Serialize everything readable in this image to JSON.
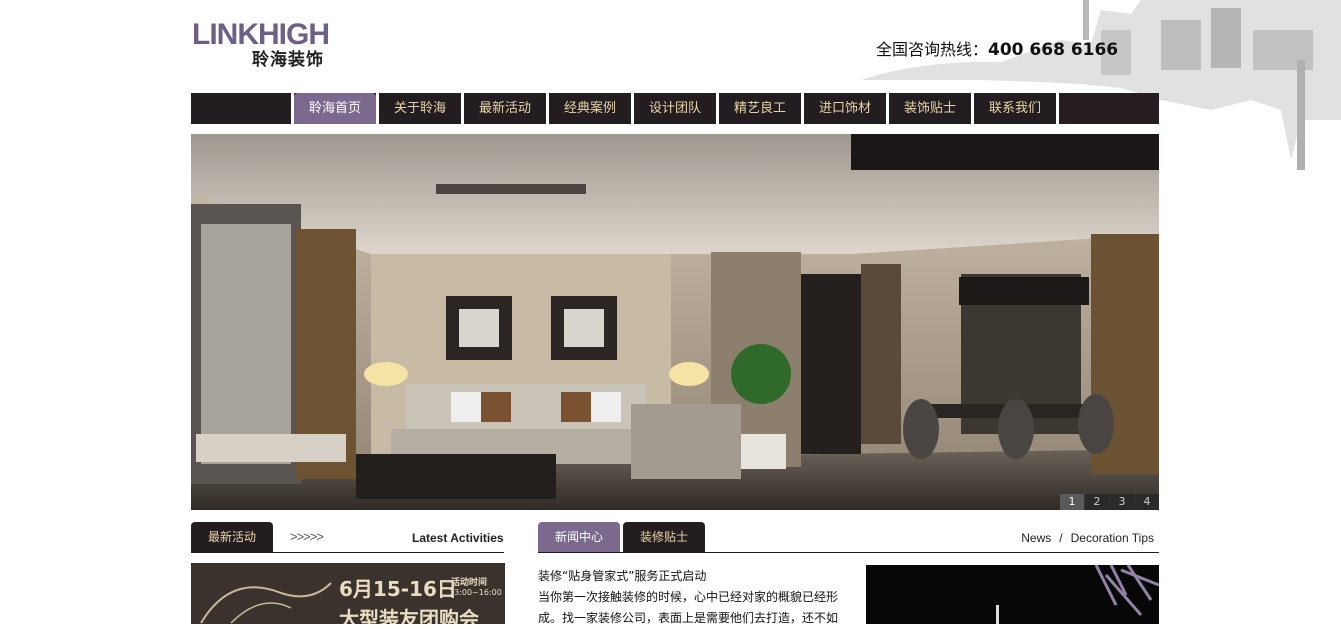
{
  "brand": {
    "logo_en": "LINKHIGH",
    "logo_cn": "聆海装饰"
  },
  "hotline": {
    "label": "全国咨询热线：",
    "number": "400 668 6166"
  },
  "nav": {
    "items": [
      {
        "label": "聆海首页",
        "active": true
      },
      {
        "label": "关于聆海"
      },
      {
        "label": "最新活动"
      },
      {
        "label": "经典案例"
      },
      {
        "label": "设计团队"
      },
      {
        "label": "精艺良工"
      },
      {
        "label": "进口饰材"
      },
      {
        "label": "装饰贴士"
      },
      {
        "label": "联系我们"
      }
    ]
  },
  "banner": {
    "pages": [
      "1",
      "2",
      "3",
      "4"
    ],
    "active_page": "1"
  },
  "activities": {
    "tab_label": "最新活动",
    "arrows": ">>>>>",
    "title_en": "Latest Activities",
    "promo": {
      "date": "6月15-16日",
      "time_label": "活动时间",
      "time": "13:00~16:00",
      "headline": "大型装友团购会"
    }
  },
  "news": {
    "tabs": [
      {
        "label": "新闻中心",
        "active": true
      },
      {
        "label": "装修贴士"
      }
    ],
    "links": [
      "News",
      "/",
      "Decoration Tips"
    ],
    "article": {
      "title": "装修“贴身管家式”服务正式启动",
      "line1": "当你第一次接触装修的时候，心中已经对家的概貌已经形",
      "line2": "成。找一家装修公司，表面上是需要他们去打造，还不如"
    }
  },
  "colors": {
    "accent": "#7b6a8e",
    "nav_bg": "#231c21",
    "nav_text": "#e8d6a5"
  }
}
